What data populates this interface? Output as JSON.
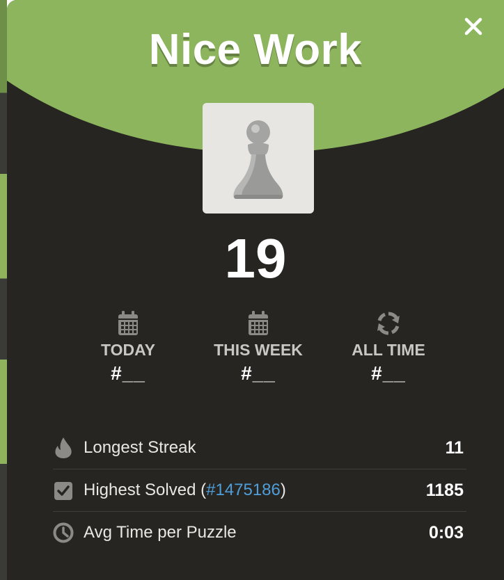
{
  "modal": {
    "title": "Nice Work",
    "close_icon": "close-icon",
    "piece_icon": "pawn-icon",
    "score": "19"
  },
  "leaderboard": [
    {
      "icon": "calendar-icon",
      "label": "TODAY",
      "rank": "#__"
    },
    {
      "icon": "calendar-icon",
      "label": "THIS WEEK",
      "rank": "#__"
    },
    {
      "icon": "refresh-icon",
      "label": "ALL TIME",
      "rank": "#__"
    }
  ],
  "stats": {
    "longest_streak": {
      "icon": "flame-icon",
      "label": "Longest Streak",
      "value": "11"
    },
    "highest_solved": {
      "icon": "checkbox-icon",
      "label_prefix": "Highest Solved (",
      "puzzle_link": "#1475186",
      "label_suffix": ")",
      "value": "1185"
    },
    "avg_time": {
      "icon": "clock-icon",
      "label": "Avg Time per Puzzle",
      "value": "0:03"
    }
  },
  "colors": {
    "header_green": "#8db55d",
    "modal_bg": "#262522",
    "link_blue": "#4f9ed9"
  }
}
